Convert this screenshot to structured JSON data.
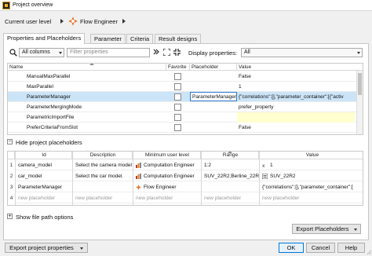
{
  "window": {
    "title": "Project overview"
  },
  "userlevel": {
    "label": "Current user level",
    "value": "Flow Engineer"
  },
  "tabs": [
    "Properties and Placeholders",
    "Parameter",
    "Criteria",
    "Result designs"
  ],
  "toolbar": {
    "columns_value": "All columns",
    "filter_placeholder": "Filter properties",
    "display_label": "Display properties:",
    "display_value": "All"
  },
  "props_table": {
    "headers": {
      "name": "Name",
      "favorite": "Favorite",
      "placeholder": "Placeholder",
      "value": "Value"
    },
    "rows": [
      {
        "name": "ManualMaxParallel",
        "placeholder": "",
        "value": "False"
      },
      {
        "name": "MaxParallel",
        "placeholder": "",
        "value": "1"
      },
      {
        "name": "ParameterManager",
        "placeholder": "ParameterManager",
        "value": "{\"correlations\":[],\"parameter_container\":[{\"activ"
      },
      {
        "name": "ParameterMergingMode",
        "placeholder": "",
        "value": "prefer_property"
      },
      {
        "name": "ParametricImportFile",
        "placeholder": "",
        "value": ""
      },
      {
        "name": "PreferCriteriaFromSlot",
        "placeholder": "",
        "value": "False"
      }
    ]
  },
  "placeholders_section": {
    "label": "Hide project placeholders"
  },
  "ph_table": {
    "headers": {
      "id": "Id",
      "description": "Description",
      "level": "Minimum user level",
      "range": "Range",
      "value": "Value"
    },
    "rows": [
      {
        "num": "1",
        "id": "camera_model",
        "description": "Select the camera model.",
        "level": "Computation Engineer",
        "range": "1:2",
        "value": "1"
      },
      {
        "num": "2",
        "id": "car_model",
        "description": "Select the car model.",
        "level": "Computation Engineer",
        "range": "SUV_22R2;Berline_22R2",
        "value": "SUV_22R2"
      },
      {
        "num": "3",
        "id": "ParameterManager",
        "description": "",
        "level": "Flow Engineer",
        "range": "",
        "value": "{\"correlations\":[],\"parameter_container\":["
      },
      {
        "num": "4",
        "id": "new placeholder",
        "description": "new placeholder",
        "level": "new placeholder",
        "range": "new placeholder",
        "value": "new placeholder"
      }
    ]
  },
  "file_path_section": {
    "label": "Show file path options"
  },
  "buttons": {
    "export_placeholders": "Export Placeholders",
    "export_properties": "Export project properties",
    "ok": "OK",
    "cancel": "Cancel",
    "help": "Help"
  },
  "icons": [
    "app-icon",
    "flow-engineer-icon",
    "search-icon",
    "forward-icon",
    "expand-icon",
    "collapse-icon",
    "computation-engineer-icon"
  ]
}
